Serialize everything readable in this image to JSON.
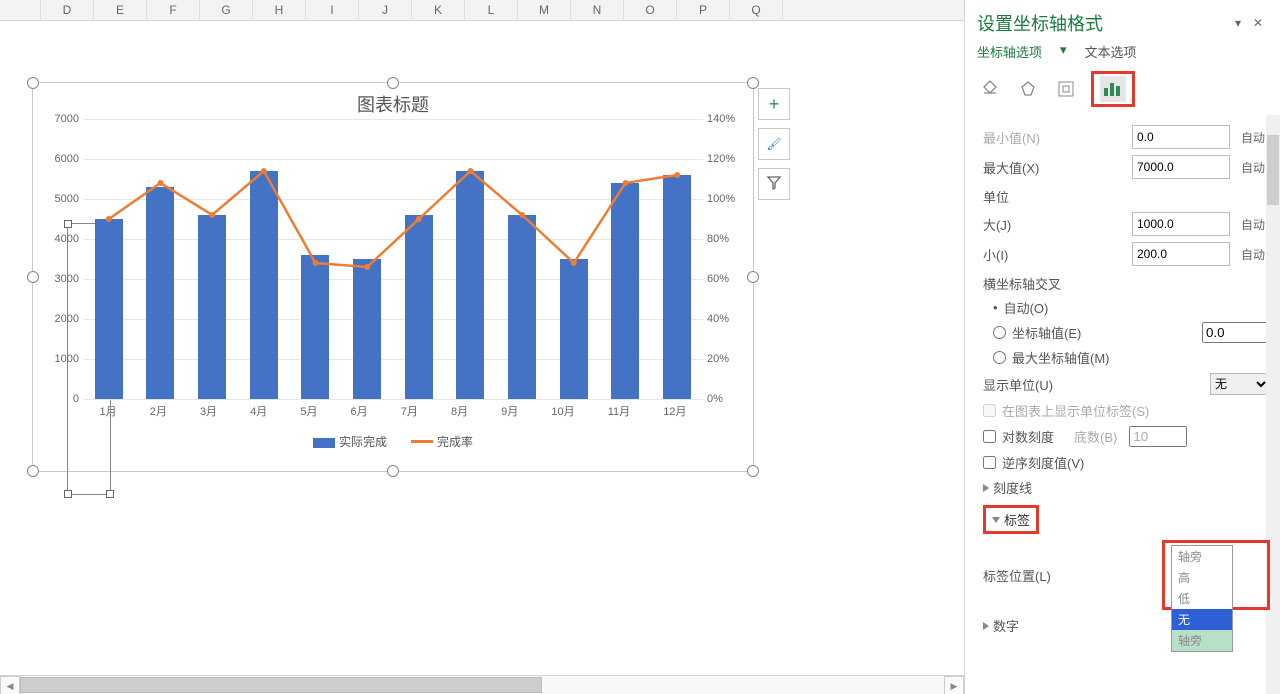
{
  "columns": [
    "",
    "D",
    "E",
    "F",
    "G",
    "H",
    "I",
    "J",
    "K",
    "L",
    "M",
    "N",
    "O",
    "P",
    "Q"
  ],
  "chart_data": {
    "type": "combo",
    "title": "图表标题",
    "categories": [
      "1月",
      "2月",
      "3月",
      "4月",
      "5月",
      "6月",
      "7月",
      "8月",
      "9月",
      "10月",
      "11月",
      "12月"
    ],
    "series": [
      {
        "name": "实际完成",
        "type": "bar",
        "axis": "primary",
        "values": [
          4500,
          5300,
          4600,
          5700,
          3600,
          3500,
          4600,
          5700,
          4600,
          3500,
          5400,
          5600
        ]
      },
      {
        "name": "完成率",
        "type": "line",
        "axis": "secondary",
        "values": [
          90,
          108,
          92,
          114,
          68,
          66,
          90,
          114,
          92,
          68,
          108,
          112
        ]
      }
    ],
    "y_primary": {
      "min": 0,
      "max": 7000,
      "ticks": [
        0,
        1000,
        2000,
        3000,
        4000,
        5000,
        6000,
        7000
      ]
    },
    "y_secondary": {
      "min": 0,
      "max": 140,
      "unit": "%",
      "ticks": [
        0,
        20,
        40,
        60,
        80,
        100,
        120,
        140
      ]
    }
  },
  "side_buttons": {
    "add": "+",
    "brush": "✎",
    "filter": "▽"
  },
  "panel": {
    "title": "设置坐标轴格式",
    "tab_axis": "坐标轴选项",
    "tab_text": "文本选项",
    "min_label": "最小值(N)",
    "min_val": "0.0",
    "auto": "自动",
    "max_label": "最大值(X)",
    "max_val": "7000.0",
    "unit_header": "单位",
    "major_label": "大(J)",
    "major_val": "1000.0",
    "minor_label": "小(I)",
    "minor_val": "200.0",
    "cross_header": "横坐标轴交叉",
    "cross_auto": "自动(O)",
    "cross_val_lab": "坐标轴值(E)",
    "cross_val": "0.0",
    "cross_max": "最大坐标轴值(M)",
    "disp_unit_lab": "显示单位(U)",
    "disp_unit_val": "无",
    "show_unit_cb": "在图表上显示单位标签(S)",
    "log_cb": "对数刻度",
    "log_base_lab": "底数(B)",
    "log_base": "10",
    "rev_cb": "逆序刻度值(V)",
    "ticks_header": "刻度线",
    "labels_header": "标签",
    "label_pos_lab": "标签位置(L)",
    "num_header": "数字",
    "pos_opts": [
      "轴旁",
      "高",
      "低",
      "无",
      "轴旁"
    ],
    "pos_selected": "无"
  }
}
